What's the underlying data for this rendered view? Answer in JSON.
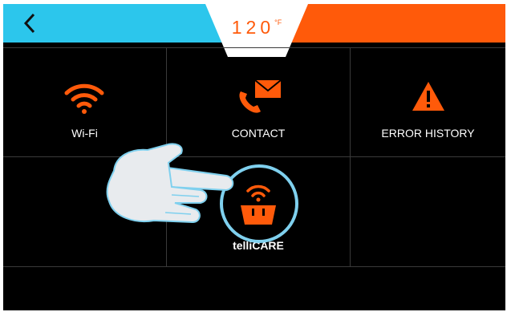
{
  "header": {
    "temperature": "120",
    "unit": "°F",
    "back_icon": "chevron-left-icon",
    "colors": {
      "left": "#2cc6ec",
      "right": "#ff5a0a",
      "accent": "#ff5a0a"
    }
  },
  "menu": {
    "wifi": {
      "label": "Wi-Fi",
      "icon": "wifi-icon"
    },
    "contact": {
      "label": "CONTACT",
      "icon": "contact-icon"
    },
    "error_history": {
      "label": "ERROR HISTORY",
      "icon": "warning-icon"
    },
    "tellicare": {
      "label": "telliCARE",
      "icon": "tellicare-icon"
    }
  },
  "overlay": {
    "icon": "pointing-hand-icon",
    "highlight_color": "#7fd0ee"
  }
}
